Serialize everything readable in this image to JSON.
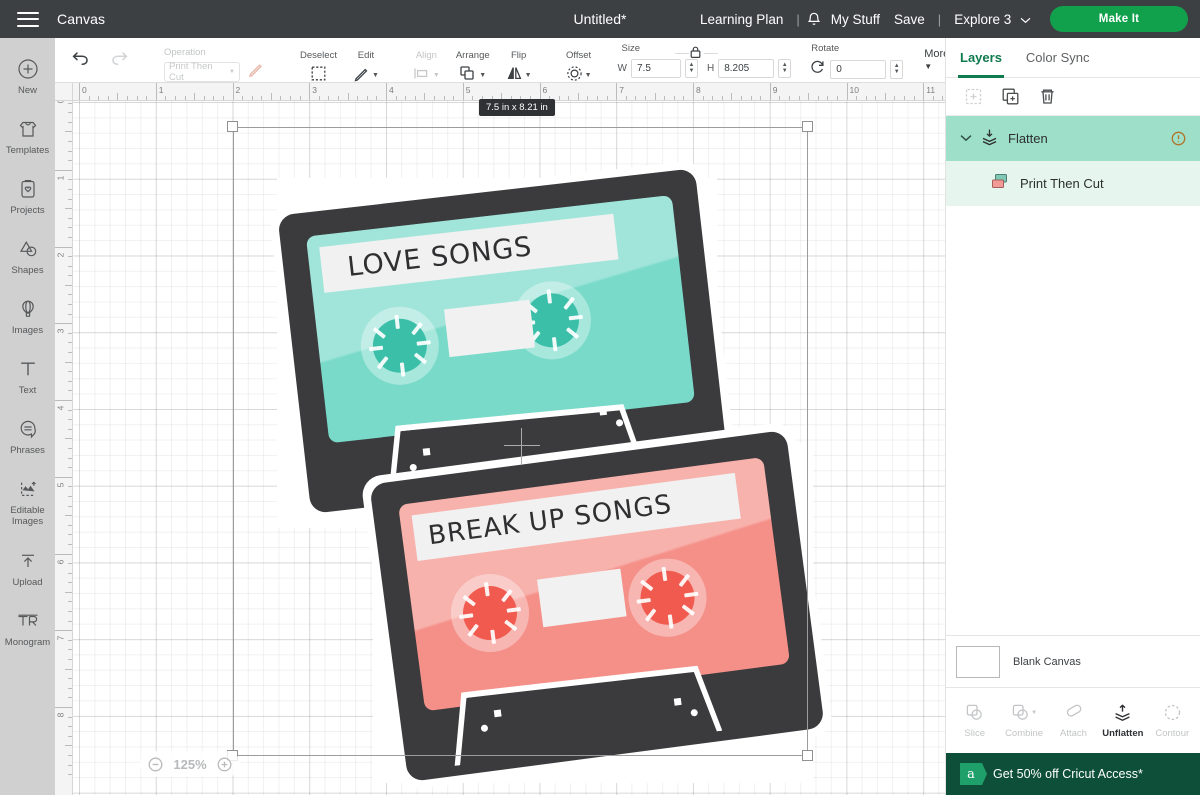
{
  "topbar": {
    "menu_icon": "hamburger-icon",
    "canvas_label": "Canvas",
    "project_title": "Untitled*",
    "learning_plan": "Learning Plan",
    "separator": "|",
    "bell_icon": "bell-icon",
    "my_stuff": "My Stuff",
    "save": "Save",
    "machine": "Explore 3",
    "make_it": "Make It",
    "accent_green": "#11a14c",
    "bg": "#3c4043"
  },
  "rail": {
    "items": [
      {
        "label": "New",
        "icon": "plus-circle-icon"
      },
      {
        "label": "Templates",
        "icon": "tshirt-icon"
      },
      {
        "label": "Projects",
        "icon": "clipboard-heart-icon"
      },
      {
        "label": "Shapes",
        "icon": "shapes-icon"
      },
      {
        "label": "Images",
        "icon": "hot-air-balloon-icon"
      },
      {
        "label": "Text",
        "icon": "text-t-icon"
      },
      {
        "label": "Phrases",
        "icon": "speech-bubble-icon"
      },
      {
        "label": "Editable\nImages",
        "label_1": "Editable",
        "label_2": "Images",
        "icon": "editable-images-icon"
      },
      {
        "label": "Upload",
        "icon": "upload-arrow-icon"
      },
      {
        "label": "Monogram",
        "icon": "monogram-icon"
      }
    ]
  },
  "toolbar": {
    "undo": "undo-icon",
    "redo": "redo-icon",
    "operation_label": "Operation",
    "operation_value": "Print Then Cut",
    "operation_pencil": "pencil-icon",
    "deselect_label": "Deselect",
    "deselect_icon": "marquee-select-icon",
    "edit_label": "Edit",
    "edit_icon": "pencil-edit-icon",
    "align_label": "Align",
    "align_icon": "align-icon",
    "arrange_label": "Arrange",
    "arrange_icon": "arrange-layers-icon",
    "flip_label": "Flip",
    "flip_icon": "flip-horizontal-icon",
    "offset_label": "Offset",
    "offset_icon": "offset-icon",
    "size_label": "Size",
    "lock_icon": "lock-closed-icon",
    "width_label": "W",
    "width_value": "7.5",
    "height_label": "H",
    "height_value": "8.205",
    "rotate_label": "Rotate",
    "rotate_icon": "rotate-icon",
    "rotate_value": "0",
    "more_label": "More"
  },
  "canvas": {
    "size_badge": "7.5 in x 8.21 in",
    "zoom_level": "125%",
    "zoom_out_icon": "minus-circle-icon",
    "zoom_in_icon": "plus-circle-icon",
    "ruler_h_ticks": [
      "0",
      "1",
      "2",
      "3",
      "4",
      "5",
      "6",
      "7",
      "8",
      "9",
      "10",
      "11"
    ],
    "ruler_v_ticks": [
      "0",
      "1",
      "2",
      "3",
      "4",
      "5",
      "6",
      "7",
      "8"
    ],
    "artwork": [
      {
        "name": "love-songs-cassette",
        "title": "LOVE SONGS",
        "body_color": "#79DACA",
        "reel_color": "#3CBFA8",
        "shell_color": "#3b3b3d",
        "label_color": "#f0f1f0"
      },
      {
        "name": "break-up-songs-cassette",
        "title": "BREAK UP SONGS",
        "body_color": "#F59089",
        "reel_color": "#F05A4F",
        "shell_color": "#3b3b3d",
        "label_color": "#f0f1f0"
      }
    ]
  },
  "right_panel": {
    "tabs": [
      {
        "label": "Layers",
        "active": true
      },
      {
        "label": "Color Sync",
        "active": false
      }
    ],
    "tools": [
      {
        "name": "group-icon",
        "enabled": false
      },
      {
        "name": "duplicate-icon",
        "enabled": true
      },
      {
        "name": "delete-trash-icon",
        "enabled": true
      }
    ],
    "layers": [
      {
        "name": "Flatten",
        "icon": "flatten-icon",
        "type": "group",
        "expanded": true,
        "warning": true
      },
      {
        "name": "Print Then Cut",
        "icon": "print-then-cut-icon",
        "type": "child"
      }
    ],
    "blank_canvas_label": "Blank Canvas",
    "operations": [
      {
        "label": "Slice",
        "icon": "slice-icon",
        "enabled": false
      },
      {
        "label": "Combine",
        "icon": "combine-icon",
        "enabled": false,
        "caret": true
      },
      {
        "label": "Attach",
        "icon": "paperclip-icon",
        "enabled": false
      },
      {
        "label": "Unflatten",
        "icon": "unflatten-icon",
        "enabled": true
      },
      {
        "label": "Contour",
        "icon": "contour-icon",
        "enabled": false
      }
    ],
    "promo": {
      "text": "Get 50% off Cricut Access*",
      "icon": "cricut-a-icon",
      "bg": "#0d4f38"
    }
  }
}
